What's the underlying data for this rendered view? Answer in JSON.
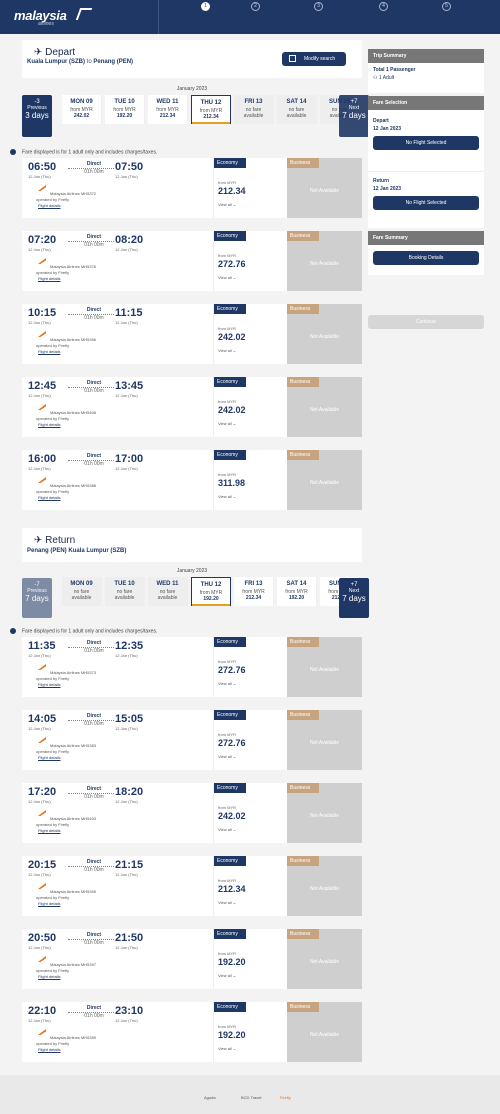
{
  "brand": {
    "logo": "malaysia",
    "sub": "airlines"
  },
  "steps": [
    "1",
    "2",
    "3",
    "4",
    "5"
  ],
  "depart": {
    "title": "Depart",
    "from": "Kuala Lumpur (SZB)",
    "to_word": "to",
    "to": "Penang (PEN)",
    "modify": "Modify search",
    "month": "January 2023",
    "prev": {
      "num": "-3",
      "label": "Previous",
      "days": "3 days"
    },
    "next": {
      "num": "+7",
      "label": "Next",
      "days": "7 days"
    },
    "dates": [
      {
        "day": "MON 09",
        "l1": "from MYR",
        "l2": "242.02",
        "na": false
      },
      {
        "day": "TUE 10",
        "l1": "from MYR",
        "l2": "192.20",
        "na": false
      },
      {
        "day": "WED 11",
        "l1": "from MYR",
        "l2": "212.34",
        "na": false
      },
      {
        "day": "THU 12",
        "l1": "from MYR",
        "l2": "212.34",
        "na": false,
        "sel": true
      },
      {
        "day": "FRI 13",
        "l1": "no fare",
        "l2": "available",
        "na": true
      },
      {
        "day": "SAT 14",
        "l1": "no fare",
        "l2": "available",
        "na": true
      },
      {
        "day": "SUN 15",
        "l1": "no fare",
        "l2": "available",
        "na": true
      }
    ],
    "info": "Fare displayed is for 1 adult only and includes charges/taxes.",
    "flights": [
      {
        "dep": "06:50",
        "arr": "07:50",
        "dd": "12 Jan (Thu)",
        "ad": "12 Jan (Thu)",
        "direct": "Direct",
        "dur": "01h 00m",
        "airline": "Malaysia Airlines  MH5372",
        "op": "operated by Firefly",
        "fd": "Flight details",
        "price": "212.34"
      },
      {
        "dep": "07:20",
        "arr": "08:20",
        "dd": "12 Jan (Thu)",
        "ad": "12 Jan (Thu)",
        "direct": "Direct",
        "dur": "01h 00m",
        "airline": "Malaysia Airlines  MH5376",
        "op": "operated by Firefly",
        "fd": "Flight details",
        "price": "272.76"
      },
      {
        "dep": "10:15",
        "arr": "11:15",
        "dd": "12 Jan (Thu)",
        "ad": "12 Jan (Thu)",
        "direct": "Direct",
        "dur": "01h 00m",
        "airline": "Malaysia Airlines  MH5396",
        "op": "operated by Firefly",
        "fd": "Flight details",
        "price": "242.02"
      },
      {
        "dep": "12:45",
        "arr": "13:45",
        "dd": "12 Jan (Thu)",
        "ad": "12 Jan (Thu)",
        "direct": "Direct",
        "dur": "01h 00m",
        "airline": "Malaysia Airlines  MH5408",
        "op": "operated by Firefly",
        "fd": "Flight details",
        "price": "242.02"
      },
      {
        "dep": "16:00",
        "arr": "17:00",
        "dd": "12 Jan (Thu)",
        "ad": "12 Jan (Thu)",
        "direct": "Direct",
        "dur": "01h 00m",
        "airline": "Malaysia Airlines  MH5388",
        "op": "operated by Firefly",
        "fd": "Flight details",
        "price": "311.98"
      }
    ]
  },
  "return": {
    "title": "Return",
    "from": "Penang (PEN)",
    "to": "Kuala Lumpur (SZB)",
    "month": "January 2023",
    "prev": {
      "num": "-7",
      "label": "Previous",
      "days": "7 days"
    },
    "next": {
      "num": "+7",
      "label": "Next",
      "days": "7 days"
    },
    "dates": [
      {
        "day": "MON 09",
        "l1": "no fare",
        "l2": "available",
        "na": true
      },
      {
        "day": "TUE 10",
        "l1": "no fare",
        "l2": "available",
        "na": true
      },
      {
        "day": "WED 11",
        "l1": "no fare",
        "l2": "available",
        "na": true
      },
      {
        "day": "THU 12",
        "l1": "from MYR",
        "l2": "192.20",
        "na": false,
        "sel": true
      },
      {
        "day": "FRI 13",
        "l1": "from MYR",
        "l2": "212.34",
        "na": false
      },
      {
        "day": "SAT 14",
        "l1": "from MYR",
        "l2": "192.20",
        "na": false
      },
      {
        "day": "SUN 15",
        "l1": "from MYR",
        "l2": "212.34",
        "na": false
      }
    ],
    "info": "Fare displayed is for 1 adult only and includes charges/taxes.",
    "flights": [
      {
        "dep": "11:35",
        "arr": "12:35",
        "dd": "12 Jan (Thu)",
        "ad": "12 Jan (Thu)",
        "direct": "Direct",
        "dur": "01h 00m",
        "airline": "Malaysia Airlines  MH5373",
        "op": "operated by Firefly",
        "fd": "Flight details",
        "price": "272.76"
      },
      {
        "dep": "14:05",
        "arr": "15:05",
        "dd": "12 Jan (Thu)",
        "ad": "12 Jan (Thu)",
        "direct": "Direct",
        "dur": "01h 00m",
        "airline": "Malaysia Airlines  MH5383",
        "op": "operated by Firefly",
        "fd": "Flight details",
        "price": "272.76"
      },
      {
        "dep": "17:20",
        "arr": "18:20",
        "dd": "12 Jan (Thu)",
        "ad": "12 Jan (Thu)",
        "direct": "Direct",
        "dur": "01h 00m",
        "airline": "Malaysia Airlines  MH5403",
        "op": "operated by Firefly",
        "fd": "Flight details",
        "price": "242.02"
      },
      {
        "dep": "20:15",
        "arr": "21:15",
        "dd": "12 Jan (Thu)",
        "ad": "12 Jan (Thu)",
        "direct": "Direct",
        "dur": "01h 00m",
        "airline": "Malaysia Airlines  MH5395",
        "op": "operated by Firefly",
        "fd": "Flight details",
        "price": "212.34"
      },
      {
        "dep": "20:50",
        "arr": "21:50",
        "dd": "12 Jan (Thu)",
        "ad": "12 Jan (Thu)",
        "direct": "Direct",
        "dur": "01h 00m",
        "airline": "Malaysia Airlines  MH5397",
        "op": "operated by Firefly",
        "fd": "Flight details",
        "price": "192.20"
      },
      {
        "dep": "22:10",
        "arr": "23:10",
        "dd": "12 Jan (Thu)",
        "ad": "12 Jan (Thu)",
        "direct": "Direct",
        "dur": "01h 00m",
        "airline": "Malaysia Airlines  MH5399",
        "op": "operated by Firefly",
        "fd": "Flight details",
        "price": "192.20"
      }
    ]
  },
  "fare": {
    "economy": "Economy",
    "business": "Business",
    "from": "from  MYR",
    "view_all": "View all ⌄",
    "not_available": "Not Available"
  },
  "sidebar": {
    "trip_summary": "Trip Summary",
    "passengers": "Total 1 Passenger",
    "adult": "1 Adult",
    "fare_selection": "Fare Selection",
    "depart_label": "Depart",
    "depart_date": "12 Jan 2023",
    "return_label": "Return",
    "return_date": "12 Jan 2023",
    "no_flight": "No Flight Selected",
    "fare_summary": "Fare Summary",
    "booking_details": "Booking Details",
    "continue": "Continue"
  },
  "footer": {
    "logos": [
      "Agoda",
      "BCD Travel",
      "Firefly"
    ]
  }
}
